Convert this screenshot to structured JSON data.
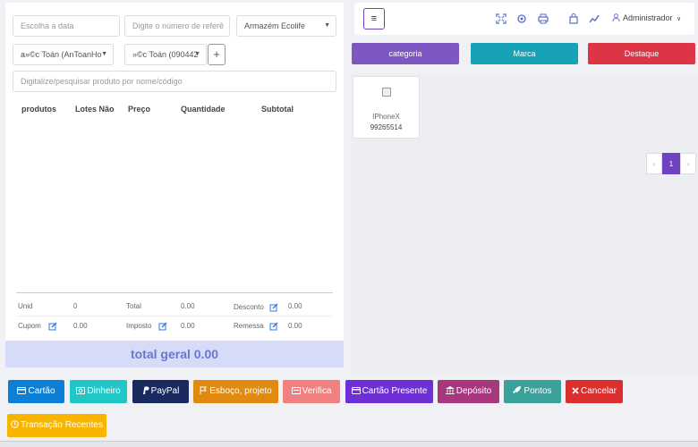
{
  "filters": {
    "date_placeholder": "Escolha a data",
    "reference_placeholder": "Digite o número de referê",
    "warehouse": "Armazém Ecolife",
    "customer": "a»©c Toán (AnToanHo",
    "customer2": "»©c Toán (090442",
    "add_label": "+",
    "scan_placeholder": "Digitalize/pesquisar produto por nome/código"
  },
  "table": {
    "headers": [
      "produtos",
      "Lotes Não",
      "Preço",
      "Quantidade",
      "Subtotal"
    ]
  },
  "summary": {
    "unit_label": "Unid",
    "unit_value": "0",
    "total_label": "Total",
    "total_value": "0.00",
    "discount_label": "Desconto",
    "discount_value": "0.00",
    "coupon_label": "Cupom",
    "coupon_value": "0.00",
    "tax_label": "Imposto",
    "tax_value": "0.00",
    "shipping_label": "Remessa",
    "shipping_value": "0.00",
    "grand_total": "total geral 0.00"
  },
  "topbar": {
    "menu_icon": "hamburger-icon",
    "user": "Administrador"
  },
  "categories": [
    {
      "label": "categoria",
      "color": "#7e57c2"
    },
    {
      "label": "Marca",
      "color": "#17a2b8"
    },
    {
      "label": "Destaque",
      "color": "#dc3545"
    }
  ],
  "products": [
    {
      "name": "IPhoneX",
      "code": "99265514"
    }
  ],
  "pagination": {
    "prev": "‹",
    "current": "1",
    "next": "›"
  },
  "payments": [
    {
      "label": "Cartão",
      "color": "#0d7fd6"
    },
    {
      "label": "Dinheiro",
      "color": "#21c6c6"
    },
    {
      "label": "PayPal",
      "color": "#1b2a5e"
    },
    {
      "label": "Esboço, projeto",
      "color": "#e08a12"
    },
    {
      "label": "Verifica",
      "color": "#f28080"
    },
    {
      "label": "Cartão Presente",
      "color": "#6f2fd6"
    },
    {
      "label": "Depósito",
      "color": "#a8387e"
    },
    {
      "label": "Pontos",
      "color": "#3aa19a"
    },
    {
      "label": "Cancelar",
      "color": "#dc2f2f"
    },
    {
      "label": "Transação Recentes",
      "color": "#f7b500"
    }
  ]
}
